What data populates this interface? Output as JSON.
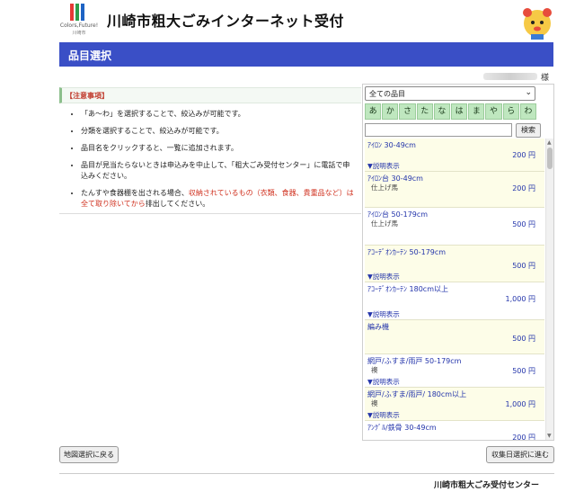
{
  "header": {
    "logo_text": "Colors,Future!",
    "logo_sub": "川崎市",
    "title": "川崎市粗大ごみインターネット受付"
  },
  "page_title": "品目選択",
  "user": {
    "suffix": "様"
  },
  "notes": {
    "heading": "【注意事項】",
    "items": [
      "「あ～わ」を選択することで、絞込みが可能です。",
      "分類を選択することで、絞込みが可能です。",
      "品目名をクリックすると、一覧に追加されます。",
      "品目が見当たらないときは申込みを中止して、「粗大ごみ受付センター」に電話で申込みください。"
    ],
    "last_pre": "たんすや食器棚を出される場合、",
    "last_red": "収納されているもの（衣類、食器、貴重品など）は全て取り除いてから",
    "last_post": "排出してください。"
  },
  "filter": {
    "category_selected": "全ての品目",
    "kana": [
      "あ",
      "か",
      "さ",
      "た",
      "な",
      "は",
      "ま",
      "や",
      "ら",
      "わ"
    ],
    "search_button": "検索"
  },
  "items": [
    {
      "name": "ｱｲﾛﾝ 30-49cm",
      "note": "",
      "price": "200 円",
      "desc": "▼説明表示"
    },
    {
      "name": "ｱｲﾛﾝ台 30-49cm",
      "note": "仕上げ馬",
      "price": "200 円",
      "desc": ""
    },
    {
      "name": "ｱｲﾛﾝ台 50-179cm",
      "note": "仕上げ馬",
      "price": "500 円",
      "desc": ""
    },
    {
      "name": "ｱｺｰﾃﾞｵﾝｶｰﾃﾝ 50-179cm",
      "note": "",
      "price": "500 円",
      "desc": "▼説明表示"
    },
    {
      "name": "ｱｺｰﾃﾞｵﾝｶｰﾃﾝ 180cm以上",
      "note": "",
      "price": "1,000 円",
      "desc": "▼説明表示"
    },
    {
      "name": "編み機",
      "note": "",
      "price": "500 円",
      "desc": ""
    },
    {
      "name": "網戸/ふすま/雨戸 50-179cm",
      "note": "襖",
      "price": "500 円",
      "desc": "▼説明表示"
    },
    {
      "name": "網戸/ふすま/雨戸/ 180cm以上",
      "note": "襖",
      "price": "1,000 円",
      "desc": "▼説明表示"
    },
    {
      "name": "ｱﾝｸﾞﾙ/鉄骨 30-49cm",
      "note": "",
      "price": "200 円",
      "desc": ""
    }
  ],
  "buttons": {
    "back": "地図選択に戻る",
    "next": "収集日選択に進む"
  },
  "footer": "川崎市粗大ごみ受付センター",
  "colors": {
    "title_bar": "#3a4fc6",
    "kana_bg": "#bfe7bf",
    "item_text": "#2233aa",
    "warning_red": "#d0311f"
  }
}
